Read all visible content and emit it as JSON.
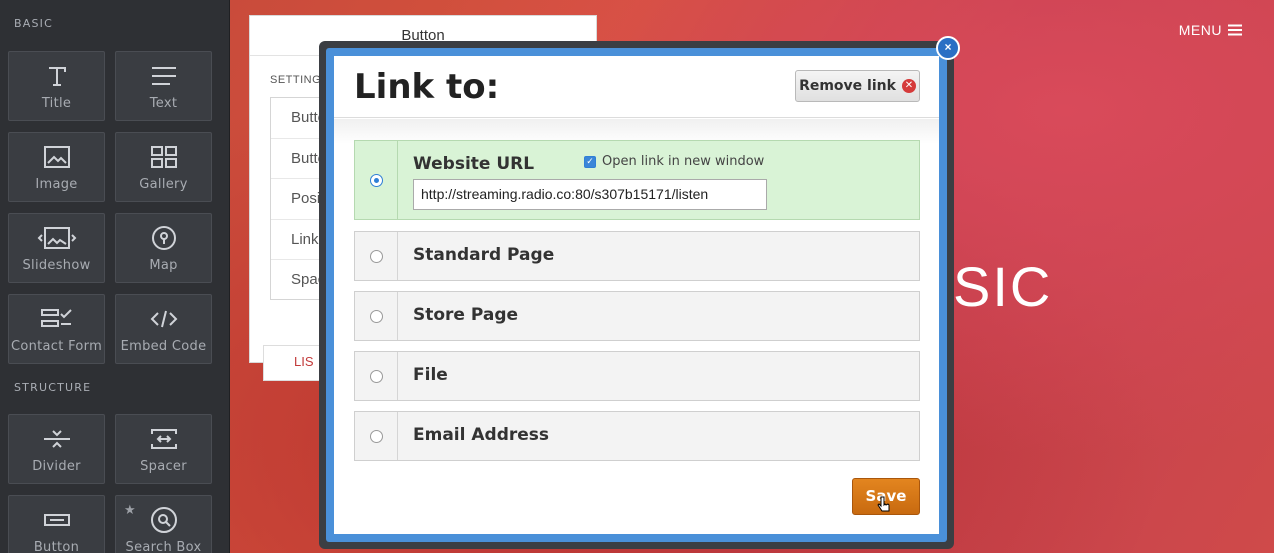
{
  "sidebar": {
    "basic_title": "BASIC",
    "structure_title": "STRUCTURE",
    "basic_items": [
      {
        "label": "Title",
        "icon": "title-icon"
      },
      {
        "label": "Text",
        "icon": "text-icon"
      },
      {
        "label": "Image",
        "icon": "image-icon"
      },
      {
        "label": "Gallery",
        "icon": "gallery-icon"
      },
      {
        "label": "Slideshow",
        "icon": "slideshow-icon"
      },
      {
        "label": "Map",
        "icon": "map-pin-icon"
      },
      {
        "label": "Contact Form",
        "icon": "contact-form-icon"
      },
      {
        "label": "Embed Code",
        "icon": "code-icon"
      }
    ],
    "structure_items": [
      {
        "label": "Divider",
        "icon": "divider-icon"
      },
      {
        "label": "Spacer",
        "icon": "spacer-icon"
      },
      {
        "label": "Button",
        "icon": "button-icon"
      },
      {
        "label": "Search Box",
        "icon": "search-icon"
      }
    ]
  },
  "site": {
    "menu_label": "MENU",
    "hero_text": "SIC"
  },
  "settings_panel": {
    "title": "Button",
    "section_label": "SETTINGS",
    "rows": [
      "Butto",
      "Butto",
      "Positi",
      "Link",
      "Spac"
    ],
    "list_tab": "LIS"
  },
  "modal": {
    "title": "Link to:",
    "remove_label": "Remove link",
    "options": {
      "website_url": "Website URL",
      "open_new_window": "Open link in new window",
      "url_value": "http://streaming.radio.co:80/s307b15171/listen",
      "standard_page": "Standard Page",
      "store_page": "Store Page",
      "file": "File",
      "email": "Email Address"
    },
    "save_label": "Save",
    "close_label": "×"
  },
  "colors": {
    "accent_blue": "#4a90d9",
    "save_orange": "#d97818",
    "active_green": "#d9f3d6",
    "remove_red": "#d53a3a"
  }
}
